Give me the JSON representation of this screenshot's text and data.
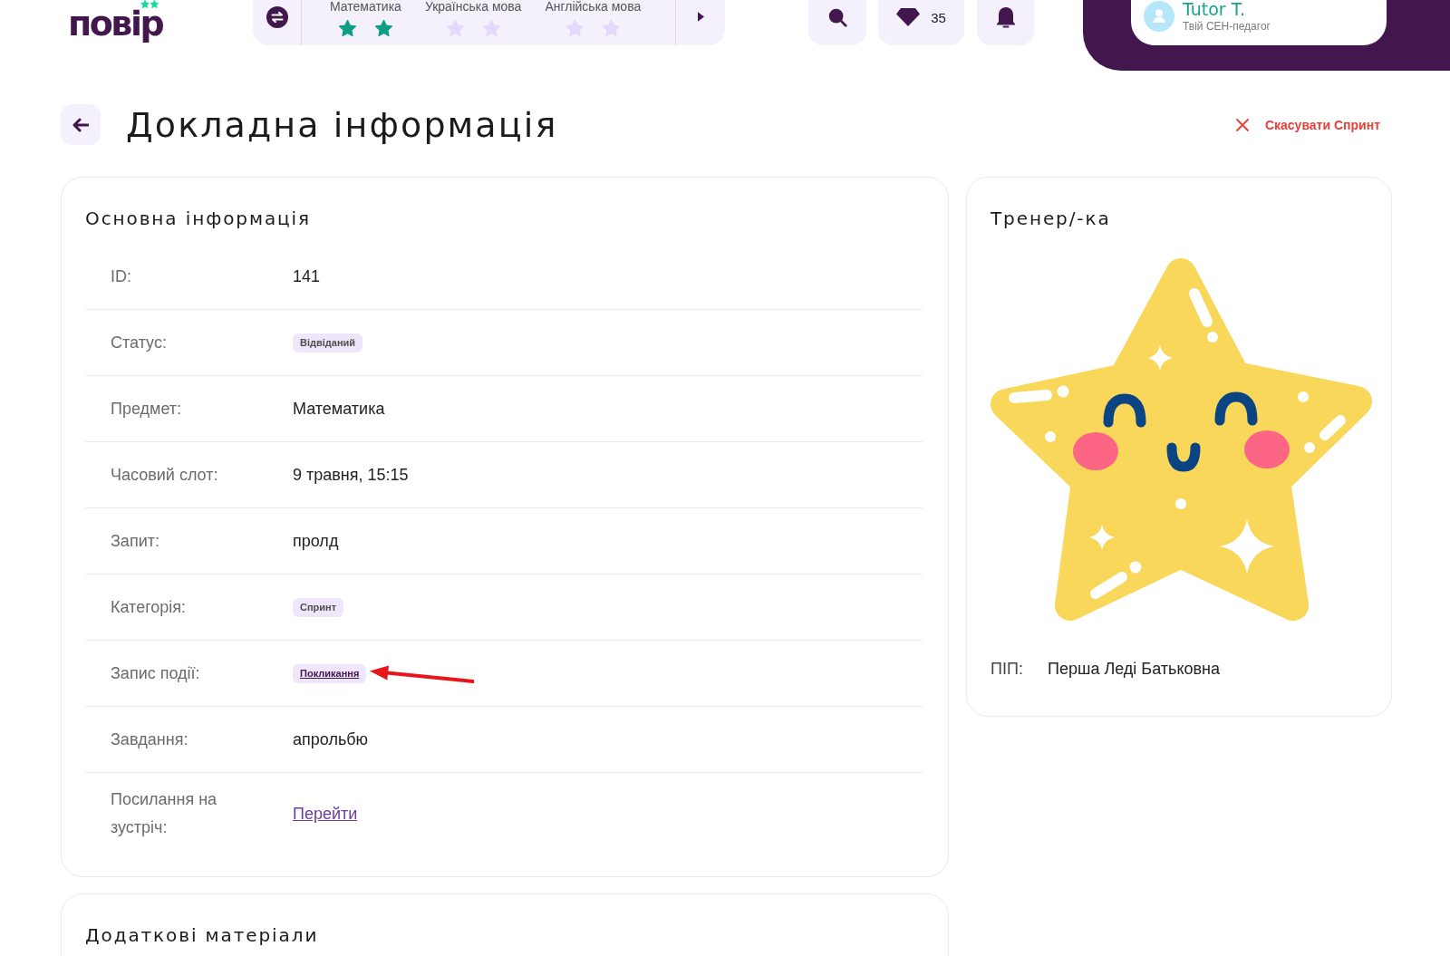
{
  "header": {
    "logo": "повір",
    "subjects": [
      {
        "name": "Математика",
        "star_icons": [
          {
            "filled": true
          },
          {
            "filled": true
          }
        ]
      },
      {
        "name": "Українська мова",
        "star_icons": [
          {
            "filled": false
          },
          {
            "filled": false
          }
        ]
      },
      {
        "name": "Англійська мова",
        "star_icons": [
          {
            "filled": false
          },
          {
            "filled": false
          }
        ]
      }
    ],
    "gems": "35",
    "user": {
      "name": "Tutor T.",
      "role": "Твій СЕН-педагог"
    }
  },
  "page": {
    "title": "Докладна інформація",
    "cancel_label": "Скасувати Спринт"
  },
  "main_info": {
    "title": "Основна інформація",
    "rows": [
      {
        "label": "ID:",
        "value": "141",
        "kind": "text",
        "annotated": false
      },
      {
        "label": "Статус:",
        "value": "Відвіданий",
        "kind": "badge",
        "annotated": false
      },
      {
        "label": "Предмет:",
        "value": "Математика",
        "kind": "text",
        "annotated": false
      },
      {
        "label": "Часовий слот:",
        "value": "9 травня, 15:15",
        "kind": "text",
        "annotated": false
      },
      {
        "label": "Запит:",
        "value": "пролд",
        "kind": "text",
        "annotated": false
      },
      {
        "label": "Категорія:",
        "value": "Спринт",
        "kind": "badge",
        "annotated": false
      },
      {
        "label": "Запис події:",
        "value": "Покликання",
        "kind": "link-badge",
        "annotated": true
      },
      {
        "label": "Завдання:",
        "value": "апрольбю",
        "kind": "text",
        "annotated": false
      },
      {
        "label": "Посилання на зустріч:",
        "value": "Перейти",
        "kind": "link",
        "annotated": false
      }
    ]
  },
  "trainer": {
    "title": "Тренер/-ка",
    "name_label": "ПІП:",
    "name": "Перша Леді Батьковна"
  },
  "extra_materials": {
    "title": "Додаткові матеріали"
  }
}
